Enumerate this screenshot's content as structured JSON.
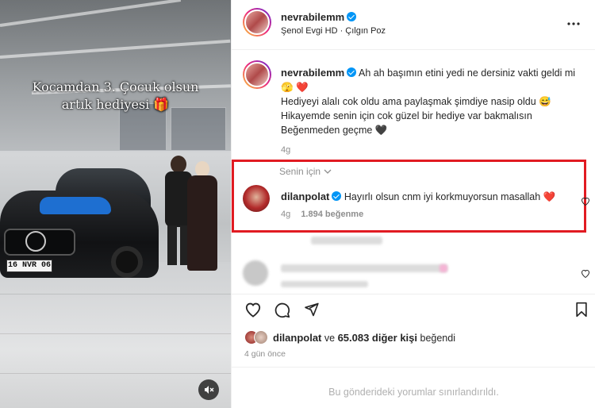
{
  "media": {
    "overlay_line1": "Kocamdan  3. Çocuk olsun",
    "overlay_line2": "artık hediyesi 🎁",
    "plate_text": "16 NVR 06",
    "mute_icon": "speaker-muted-icon"
  },
  "post": {
    "author": "nevrabilemm",
    "audio": "Şenol Evgi HD · Çılgın Poz",
    "more_icon": "more-horizontal-icon",
    "caption_line1": "Ah ah başımın etini yedi ne dersiniz vakti geldi mi",
    "caption_emojis1": "🫣 ❤️",
    "caption_line2": "Hediyeyi alalı cok oldu ama paylaşmak şimdiye nasip oldu 😅",
    "caption_line3": "Hikayemde senin için cok güzel bir hediye var bakmalısın",
    "caption_line4": "Beğenmeden geçme 🖤",
    "caption_time": "4g"
  },
  "comments": {
    "section_label": "Senin için",
    "top": {
      "author": "dilanpolat",
      "text": "Hayırlı olsun cnm iyi korkmuyorsun masallah ❤️",
      "time": "4g",
      "likes": "1.894 beğenme"
    }
  },
  "actions": {
    "like_icon": "heart-icon",
    "comment_icon": "comment-icon",
    "share_icon": "share-icon",
    "save_icon": "bookmark-icon"
  },
  "likes": {
    "user": "dilanpolat",
    "connector": "ve",
    "others": "65.083 diğer kişi",
    "suffix": "beğendi",
    "date": "4 gün önce"
  },
  "footer": {
    "limited_text": "Bu gönderideki yorumlar sınırlandırıldı."
  },
  "colors": {
    "verified": "#0095f6",
    "highlight_box": "#e11b22",
    "heart_red": "#ed4956"
  }
}
